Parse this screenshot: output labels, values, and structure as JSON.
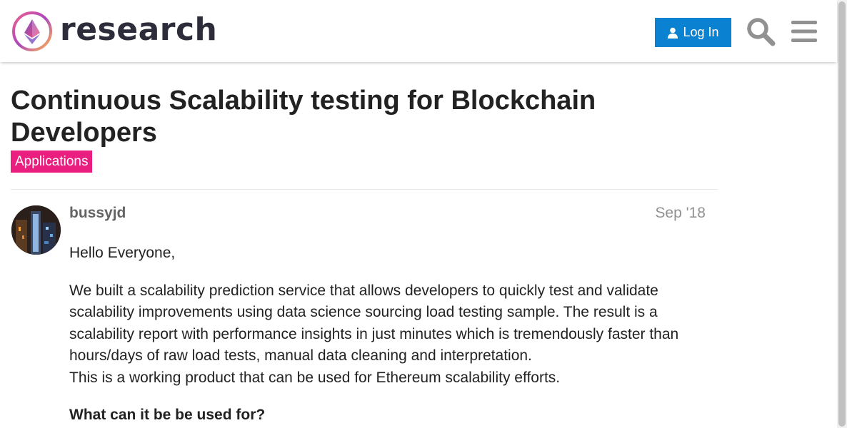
{
  "header": {
    "brand": "research",
    "login_label": "Log In",
    "icons": {
      "logo": "ethereum-research-logo",
      "user": "user-icon",
      "search": "search-icon",
      "menu": "hamburger-menu-icon"
    }
  },
  "topic": {
    "title": "Continuous Scalability testing for Blockchain Developers",
    "category": "Applications",
    "category_color": "#e91e7f"
  },
  "post": {
    "username": "bussyjd",
    "date": "Sep '18",
    "greeting": "Hello Everyone,",
    "paragraph1": "We built a scalability prediction service that allows developers to quickly test and validate scalability improvements using data science sourcing load testing sample. The result is a scalability report with performance insights in just minutes which is tremendously faster than hours/days of raw load tests, manual data cleaning and interpretation.",
    "paragraph2": "This is a working product that can be used for Ethereum scalability efforts.",
    "heading": "What can it be be used for?"
  },
  "colors": {
    "accent": "#0a81d1",
    "text": "#222222",
    "muted": "#919191"
  }
}
